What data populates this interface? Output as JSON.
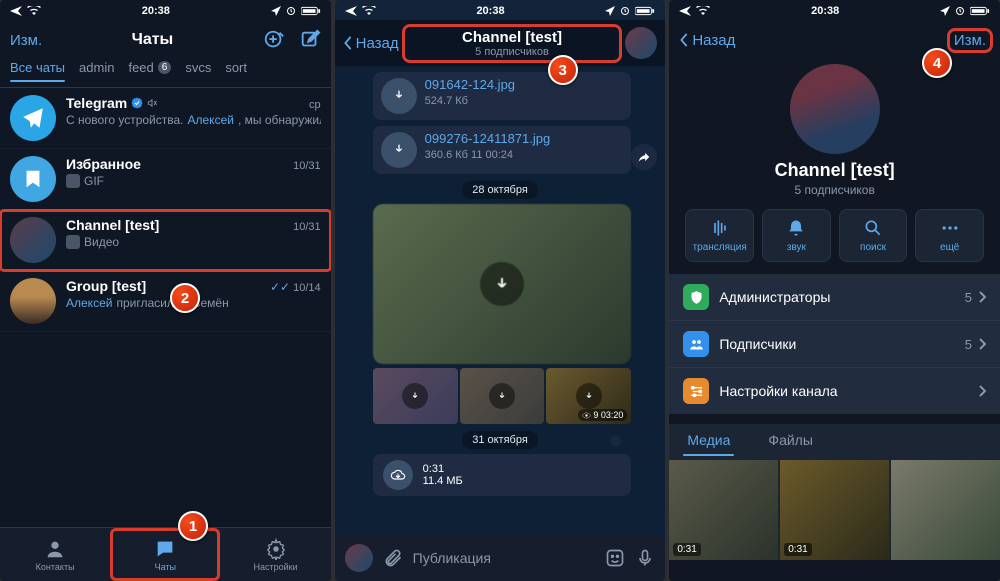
{
  "statusbar": {
    "time": "20:38"
  },
  "s1": {
    "edit": "Изм.",
    "title": "Чаты",
    "tabs": [
      "Все чаты",
      "admin",
      "feed",
      "svcs",
      "sort"
    ],
    "tab_badge": "6",
    "chats": [
      {
        "name": "Telegram",
        "date": "ср",
        "sub_prefix": "С нового устройства. ",
        "sub_name": "Алексей",
        "sub_rest": ", мы обнаружили вход в Ваш аккаунт с нов…"
      },
      {
        "name": "Избранное",
        "date": "10/31",
        "sub": "GIF"
      },
      {
        "name": "Channel [test]",
        "date": "10/31",
        "sub": "Видео"
      },
      {
        "name": "Group [test]",
        "date": "10/14",
        "sub_name": "Алексей",
        "sub_rest": " пригласил(а) Семён"
      }
    ],
    "tabbar": {
      "contacts": "Контакты",
      "chats": "Чаты",
      "settings": "Настройки"
    }
  },
  "s2": {
    "back": "Назад",
    "title": "Channel [test]",
    "subtitle": "5 подписчиков",
    "files": [
      {
        "name": "091642-124.jpg",
        "size": "524.7 Кб"
      },
      {
        "name": "099276-12411871.jpg",
        "size": "360.6 Кб",
        "time": "11 00:24"
      }
    ],
    "date1": "28 октября",
    "thumb_meta": "9 03:20",
    "date2": "31 октября",
    "dl": {
      "time": "0:31",
      "size": "11.4 МБ"
    },
    "compose": "Публикация"
  },
  "s3": {
    "back": "Назад",
    "edit": "Изм.",
    "title": "Channel [test]",
    "subtitle": "5 подписчиков",
    "actions": {
      "live": "трансляция",
      "sound": "звук",
      "search": "поиск",
      "more": "ещё"
    },
    "rows": [
      {
        "label": "Администраторы",
        "val": "5"
      },
      {
        "label": "Подписчики",
        "val": "5"
      },
      {
        "label": "Настройки канала",
        "val": ""
      }
    ],
    "segments": {
      "media": "Медиа",
      "files": "Файлы"
    },
    "durations": [
      "0:31",
      "0:31"
    ]
  },
  "callouts": {
    "1": "1",
    "2": "2",
    "3": "3",
    "4": "4"
  }
}
